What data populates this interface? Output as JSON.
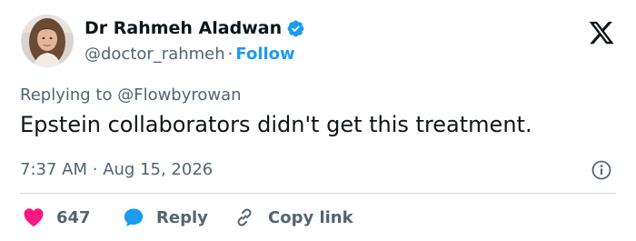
{
  "author": {
    "display_name": "Dr Rahmeh Aladwan",
    "handle": "@doctor_rahmeh",
    "separator": "·",
    "follow_label": "Follow"
  },
  "reply": {
    "prefix": "Replying to",
    "target_handle": "@Flowbyrowan"
  },
  "tweet": {
    "text": "Epstein collaborators didn't get this treatment."
  },
  "meta": {
    "time": "7:37 AM",
    "separator": "·",
    "date": "Aug 15, 2026"
  },
  "actions": {
    "like_count": "647",
    "reply_label": "Reply",
    "copy_label": "Copy link"
  },
  "colors": {
    "accent": "#1d9bf0",
    "like": "#f91880",
    "text": "#0f1419",
    "muted": "#536471",
    "divider": "#cfd9de"
  },
  "icons": {
    "verified": "verified-badge-icon",
    "brand": "x-logo-icon",
    "info": "info-icon",
    "like": "heart-icon",
    "reply": "speech-bubble-icon",
    "copy": "link-icon"
  }
}
